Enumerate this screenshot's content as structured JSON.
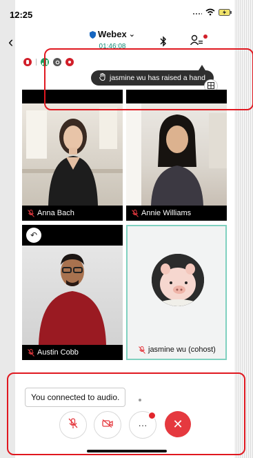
{
  "status_bar": {
    "time": "12:25"
  },
  "header": {
    "back_glyph": "‹",
    "app_title": "Webex",
    "title_chevron": "⌄",
    "call_timer": "01:46:08"
  },
  "toast": {
    "raised_hand_text": "jasmine wu has raised a hand"
  },
  "participants": [
    {
      "name": "Anna Bach"
    },
    {
      "name": "Annie Williams"
    },
    {
      "name": "Austin Cobb"
    },
    {
      "name": "jasmine wu (cohost)"
    }
  ],
  "footer": {
    "audio_toast": "You connected to audio.",
    "more_label": "···",
    "leave_label": "✕"
  },
  "colors": {
    "accent_teal": "#0f8a76",
    "alert_red": "#e1262d",
    "highlight_box": "#e0171f",
    "active_speaker_border": "#7fd0bf"
  },
  "icons": [
    "webex-shield-icon",
    "bluetooth-icon",
    "participants-icon",
    "raise-hand-icon",
    "layout-icon",
    "mic-muted-icon",
    "video-off-icon",
    "return-icon"
  ]
}
